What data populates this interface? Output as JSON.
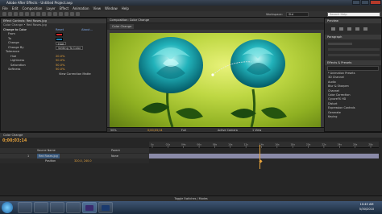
{
  "window": {
    "title": "Adobe After Effects - Untitled Project.aep"
  },
  "menu": [
    "File",
    "Edit",
    "Composition",
    "Layer",
    "Effect",
    "Animation",
    "View",
    "Window",
    "Help"
  ],
  "toolbar": {
    "workspace_label": "Workspace:",
    "workspace_value": "Std",
    "search_placeholder": "Search Help"
  },
  "effect_controls": {
    "tab": "Effect Controls: Red Roses.jpg",
    "breadcrumb": "Color Change • Red Roses.jpg",
    "effect_name": "Change to Color",
    "reset_label": "Reset",
    "about_label": "About...",
    "rows": [
      {
        "label": "From",
        "swatch": "#d42a2a"
      },
      {
        "label": "To",
        "swatch": "#1f7fb0"
      },
      {
        "label": "Change",
        "value": "Hue"
      },
      {
        "label": "Change By",
        "value": "Setting To Color"
      },
      {
        "label": "Tolerance",
        "value": ""
      },
      {
        "label": "Hue",
        "value": "20.0%"
      },
      {
        "label": "Lightness",
        "value": "50.0%"
      },
      {
        "label": "Saturation",
        "value": "50.0%"
      },
      {
        "label": "Softness",
        "value": "50.0%"
      },
      {
        "label": "",
        "value": "View Correction Matte"
      }
    ]
  },
  "composition": {
    "tab": "Composition: Color Change",
    "sub_tab": "Color Change",
    "zoom": "50%",
    "timecode": "0;00;03;14",
    "resolution": "Full",
    "camera": "Active Camera",
    "views": "1 View"
  },
  "right_panel": {
    "preview_tab": "Preview",
    "paragraph_tab": "Paragraph",
    "effects_tab": "Effects & Presets",
    "search_value": "",
    "effects": [
      "* Animation Presets",
      "3D Channel",
      "Audio",
      "Blur & Sharpen",
      "Channel",
      "Color Correction",
      "CycoreFX HD",
      "Distort",
      "Expression Controls",
      "Generate",
      "Keying"
    ]
  },
  "timeline": {
    "tab": "Color Change",
    "timecode": "0;00;03;14",
    "columns": [
      "Source Name",
      "Parent"
    ],
    "layers": [
      {
        "num": "1",
        "name": "Red Roses.jpg",
        "parent": "None"
      },
      {
        "num": "",
        "name": "Position",
        "parent": "320.0, 240.0"
      }
    ],
    "ruler_ticks": [
      "0s",
      "02s",
      "04s",
      "06s",
      "08s",
      "10s",
      "12s",
      "14s",
      "16s",
      "18s",
      "20s",
      "22s",
      "24s",
      "26s",
      "28s"
    ],
    "footer": "Toggle Switches / Modes",
    "cti_fraction": 0.48
  },
  "taskbar": {
    "time": "10:45 AM",
    "date": "5/30/2010",
    "apps": [
      "start",
      "ie",
      "explorer",
      "media",
      "chrome",
      "ae",
      "ps"
    ]
  },
  "colors": {
    "accent_orange": "#e7a33c",
    "rose_teal": "#1aa7b0",
    "background_lime": "#bfd844"
  }
}
